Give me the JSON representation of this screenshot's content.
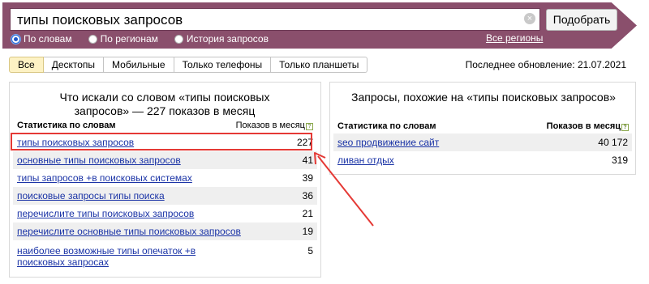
{
  "search": {
    "value": "типы поисковых запросов",
    "button": "Подобрать",
    "clear": "×"
  },
  "modes": [
    {
      "label": "По словам",
      "selected": true
    },
    {
      "label": "По регионам",
      "selected": false
    },
    {
      "label": "История запросов",
      "selected": false
    }
  ],
  "regions_link": "Все регионы",
  "device_tabs": [
    {
      "label": "Все",
      "active": true
    },
    {
      "label": "Десктопы",
      "active": false
    },
    {
      "label": "Мобильные",
      "active": false
    },
    {
      "label": "Только телефоны",
      "active": false
    },
    {
      "label": "Только планшеты",
      "active": false
    }
  ],
  "updated": "Последнее обновление: 21.07.2021",
  "left_panel": {
    "title_line1": "Что искали со словом «типы поисковых",
    "title_line2": "запросов» — 227 показов в месяц",
    "col_keyword": "Статистика по словам",
    "col_count": "Показов в месяц",
    "rows": [
      {
        "keyword": "типы поисковых запросов",
        "count": "227"
      },
      {
        "keyword": "основные типы поисковых запросов",
        "count": "41"
      },
      {
        "keyword": "типы запросов +в поисковых системах",
        "count": "39"
      },
      {
        "keyword": "поисковые запросы типы поиска",
        "count": "36"
      },
      {
        "keyword": "перечислите типы поисковых запросов",
        "count": "21"
      },
      {
        "keyword": "перечислите основные типы поисковых запросов",
        "count": "19"
      },
      {
        "keyword": "наиболее возможные типы опечаток +в",
        "keyword2": "поисковых запросах",
        "count": "5"
      }
    ]
  },
  "right_panel": {
    "title": "Запросы, похожие на «типы поисковых запросов»",
    "col_keyword": "Статистика по словам",
    "col_count": "Показов в месяц",
    "rows": [
      {
        "keyword": "seo продвижение сайт",
        "count": "40 172"
      },
      {
        "keyword": "ливан отдых",
        "count": "319"
      }
    ]
  },
  "help_glyph": "?",
  "colors": {
    "band": "#8a4f6c",
    "link": "#1a33a6",
    "highlight": "#e53935",
    "active_tab": "#fdf2c4"
  }
}
